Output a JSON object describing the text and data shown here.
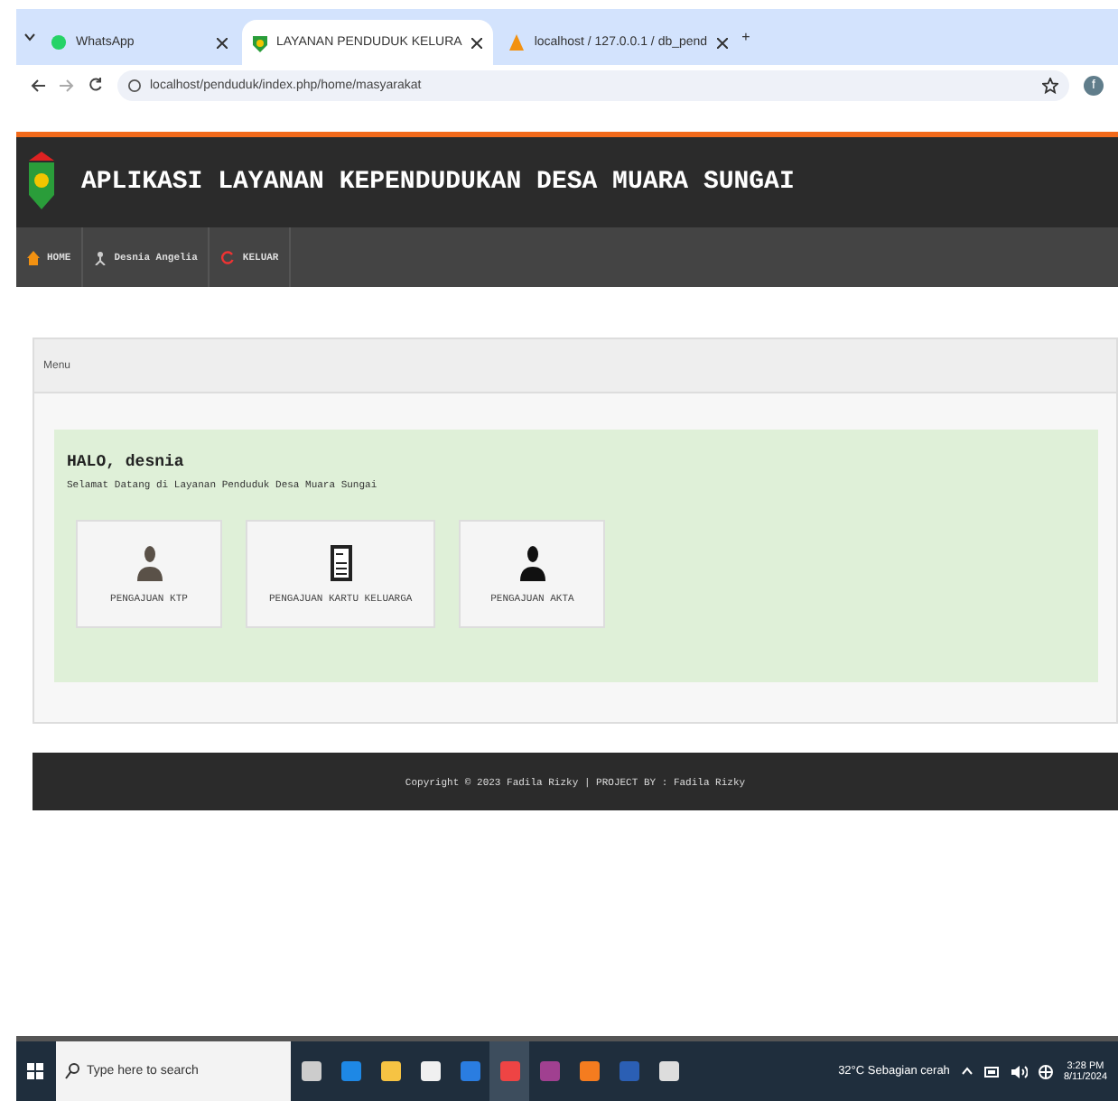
{
  "browser": {
    "tabs": [
      {
        "title": "WhatsApp",
        "selected": false,
        "kind": "whatsapp"
      },
      {
        "title": "LAYANAN PENDUDUK KELURA",
        "selected": true,
        "kind": "emblem"
      },
      {
        "title": "localhost / 127.0.0.1 / db_pend",
        "selected": false,
        "kind": "pma"
      }
    ],
    "new_tab": "+",
    "address": "localhost/penduduk/index.php/home/masyarakat",
    "profile": "f"
  },
  "header": {
    "title": "APLIKASI LAYANAN KEPENDUDUKAN DESA MUARA SUNGAI"
  },
  "nav": [
    {
      "label": "HOME",
      "kind": "home"
    },
    {
      "label": "Desnia Angelia",
      "kind": "user"
    },
    {
      "label": "KELUAR",
      "kind": "logout"
    }
  ],
  "panel": {
    "heading": "Menu",
    "greeting": "HALO, desnia",
    "welcome": "Selamat Datang di Layanan Penduduk Desa Muara Sungai",
    "tiles": [
      {
        "label": "PENGAJUAN KTP",
        "kind": "person"
      },
      {
        "label": "PENGAJUAN KARTU KELUARGA",
        "kind": "document"
      },
      {
        "label": "PENGAJUAN AKTA",
        "kind": "person-dark"
      }
    ]
  },
  "footer": "Copyright © 2023 Fadila Rizky | PROJECT BY : Fadila Rizky",
  "taskbar": {
    "search_placeholder": "Type here to search",
    "apps": [
      {
        "kind": "taskview",
        "selected": false
      },
      {
        "kind": "edge",
        "selected": false
      },
      {
        "kind": "files",
        "selected": false
      },
      {
        "kind": "store",
        "selected": false
      },
      {
        "kind": "mail",
        "selected": false
      },
      {
        "kind": "chrome",
        "selected": true
      },
      {
        "kind": "winrar",
        "selected": false
      },
      {
        "kind": "xampp",
        "selected": false
      },
      {
        "kind": "word",
        "selected": false
      },
      {
        "kind": "settings",
        "selected": false
      }
    ],
    "weather": "32°C  Sebagian cerah",
    "time": "3:28 PM",
    "date": "8/11/2024"
  }
}
